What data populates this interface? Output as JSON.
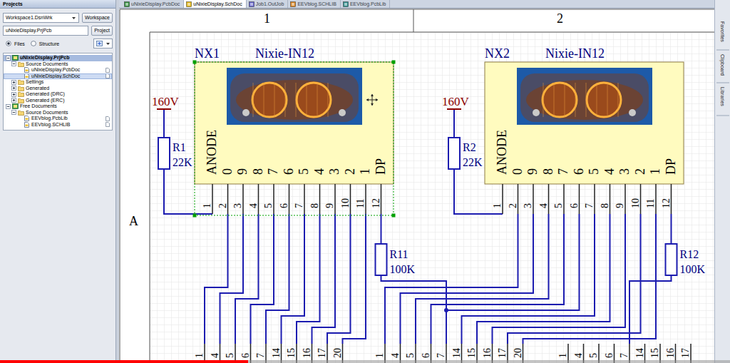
{
  "projects_panel": {
    "title": "Projects",
    "workspace": "Workspace1.DsnWrk",
    "workspace_button": "Workspace",
    "project": "uNixieDisplay.PrjPcb",
    "project_button": "Project",
    "view_options": [
      {
        "label": "Files",
        "selected": true
      },
      {
        "label": "Structure",
        "selected": false
      }
    ],
    "tree": [
      {
        "label": "uNixieDisplay.PrjPcb",
        "kind": "project",
        "expanded": true,
        "selected": true,
        "children": [
          {
            "label": "Source Documents",
            "kind": "folder",
            "expanded": true,
            "selected": false,
            "children": [
              {
                "label": "uNixieDisplay.PcbDoc",
                "kind": "document",
                "selected": false
              },
              {
                "label": "uNixieDisplay.SchDoc",
                "kind": "document",
                "selected": true
              }
            ]
          },
          {
            "label": "Settings",
            "kind": "folder",
            "expanded": false,
            "selected": false
          },
          {
            "label": "Generated",
            "kind": "folder",
            "expanded": false,
            "selected": false
          },
          {
            "label": "Generated (DRC)",
            "kind": "folder",
            "expanded": false,
            "selected": false
          },
          {
            "label": "Generated (ERC)",
            "kind": "folder",
            "expanded": false,
            "selected": false
          }
        ]
      },
      {
        "label": "Free Documents",
        "kind": "project",
        "expanded": true,
        "selected": false,
        "children": [
          {
            "label": "Source Documents",
            "kind": "folder",
            "expanded": true,
            "selected": false,
            "children": [
              {
                "label": "EEVblog.PcbLib",
                "kind": "document",
                "selected": false
              },
              {
                "label": "EEVblog.SCHLIB",
                "kind": "document",
                "selected": false
              }
            ]
          }
        ]
      }
    ]
  },
  "tabs": [
    {
      "label": "uNixieDisplay.PcbDoc",
      "kind": "pcb",
      "selected": false
    },
    {
      "label": "uNixieDisplay.SchDoc",
      "kind": "sch",
      "selected": true
    },
    {
      "label": "Job1.OutJob",
      "kind": "outjob",
      "selected": false
    },
    {
      "label": "EEVblog.SCHLIB",
      "kind": "schlib",
      "selected": false
    },
    {
      "label": "EEVblog.PcbLib",
      "kind": "pcblib",
      "selected": false
    }
  ],
  "sheet": {
    "zone_columns": [
      "1",
      "2"
    ],
    "zone_rows": [
      "A"
    ],
    "components": [
      {
        "designator": "NX1",
        "comment": "Nixie-IN12",
        "selected": true,
        "supply": "160V",
        "pin_names": [
          "ANODE",
          "0",
          "9",
          "8",
          "7",
          "6",
          "5",
          "4",
          "3",
          "2",
          "1",
          "DP"
        ],
        "pin_numbers": [
          "1",
          "2",
          "3",
          "4",
          "5",
          "6",
          "7",
          "8",
          "9",
          "10",
          "11",
          "12"
        ],
        "anode_resistor": {
          "designator": "R1",
          "value": "22K"
        },
        "dp_resistor": {
          "designator": "R11",
          "value": "100K"
        }
      },
      {
        "designator": "NX2",
        "comment": "Nixie-IN12",
        "selected": false,
        "supply": "160V",
        "pin_names": [
          "ANODE",
          "0",
          "9",
          "8",
          "7",
          "6",
          "5",
          "4",
          "3",
          "2",
          "1",
          "DP"
        ],
        "pin_numbers": [
          "1",
          "2",
          "3",
          "4",
          "5",
          "6",
          "7",
          "8",
          "9",
          "10",
          "11",
          "12"
        ],
        "anode_resistor": {
          "designator": "R2",
          "value": "22K"
        },
        "dp_resistor": {
          "designator": "R12",
          "value": "100K"
        }
      }
    ],
    "connectors": [
      {
        "pins": [
          "1",
          "4",
          "5",
          "6",
          "7",
          "14",
          "15",
          "16",
          "17",
          "20"
        ]
      },
      {
        "pins": [
          "1",
          "4",
          "5",
          "6",
          "7",
          "14",
          "15",
          "16",
          "17",
          "20"
        ]
      },
      {
        "pins": [
          "1",
          "4",
          "5",
          "6",
          "7",
          "14",
          "15",
          "16",
          "17"
        ]
      }
    ]
  },
  "side_panels": [
    "Favorites",
    "Clipboard",
    "Libraries"
  ],
  "video_progress": {
    "level": 0.34
  }
}
